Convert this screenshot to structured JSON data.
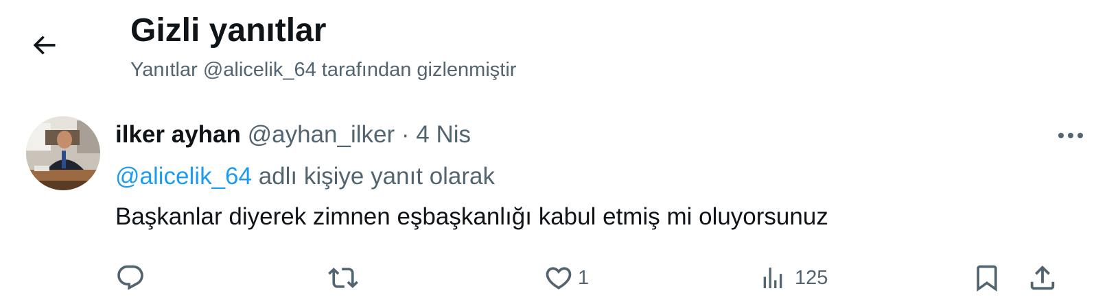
{
  "header": {
    "title": "Gizli yanıtlar",
    "subtitle": "Yanıtlar @alicelik_64 tarafından gizlenmiştir",
    "back_icon": "arrow-left-icon"
  },
  "tweet": {
    "author_name": "ilker ayhan",
    "author_handle": "@ayhan_ilker",
    "separator": "·",
    "date": "4 Nis",
    "reply_to_mention": "@alicelik_64",
    "reply_to_suffix": " adlı kişiye yanıt olarak",
    "text": "Başkanlar diyerek zimnen eşbaşkanlığı kabul etmiş mi oluyorsunuz",
    "actions": {
      "reply_count": "",
      "retweet_count": "",
      "like_count": "1",
      "views_count": "125"
    }
  },
  "colors": {
    "text_primary": "#0f1419",
    "text_secondary": "#536471",
    "link": "#1d9bf0"
  }
}
